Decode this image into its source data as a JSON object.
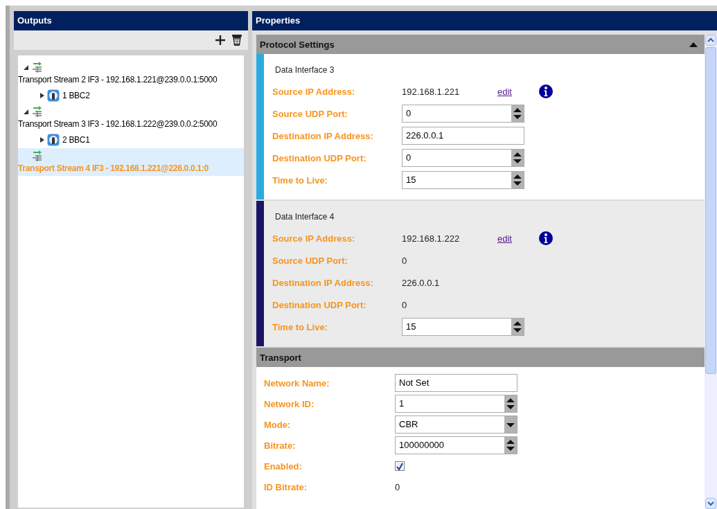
{
  "outputs": {
    "title": "Outputs",
    "toolbar": [
      {
        "kind": "add"
      },
      {
        "kind": "delete"
      }
    ],
    "tree": [
      {
        "label": "Transport Stream 2 IF3 - 192.168.1.221@239.0.0.1:5000",
        "expanded": true,
        "selected": false,
        "children": [
          {
            "label": "1 BBC2",
            "expanded": false
          }
        ]
      },
      {
        "label": "Transport Stream 3 IF3 - 192.168.1.222@239.0.0.2:5000",
        "expanded": true,
        "selected": false,
        "children": [
          {
            "label": "2 BBC1",
            "expanded": false
          }
        ]
      },
      {
        "label": "Transport Stream 4 IF3 - 192.168.1.221@226.0.0.1:0",
        "selected": true
      }
    ]
  },
  "properties": {
    "title": "Properties",
    "protocol_settings": {
      "title": "Protocol Settings",
      "expanded": true,
      "interfaces": [
        {
          "title": "Data Interface 3",
          "color": "#29abe2",
          "selected": false,
          "rows": [
            {
              "label": "Source IP Address:",
              "kind": "text",
              "value": "192.168.1.221",
              "link": "edit",
              "info": true
            },
            {
              "label": "Source UDP Port:",
              "kind": "spin",
              "value": "0"
            },
            {
              "label": "Destination IP Address:",
              "kind": "input",
              "value": "226.0.0.1"
            },
            {
              "label": "Destination UDP Port:",
              "kind": "spin",
              "value": "0"
            },
            {
              "label": "Time to Live:",
              "kind": "spin",
              "value": "15"
            }
          ]
        },
        {
          "title": "Data Interface 4",
          "color": "#1b1464",
          "selected": true,
          "rows": [
            {
              "label": "Source IP Address:",
              "kind": "text",
              "value": "192.168.1.222",
              "link": "edit",
              "info": true
            },
            {
              "label": "Source UDP Port:",
              "kind": "text",
              "value": "0"
            },
            {
              "label": "Destination IP Address:",
              "kind": "text",
              "value": "226.0.0.1"
            },
            {
              "label": "Destination UDP Port:",
              "kind": "text",
              "value": "0"
            },
            {
              "label": "Time to Live:",
              "kind": "spin",
              "value": "15"
            }
          ]
        }
      ]
    },
    "transport": {
      "title": "Transport",
      "rows": [
        {
          "label": "Network Name:",
          "kind": "input",
          "value": "Not Set"
        },
        {
          "label": "Network ID:",
          "kind": "spin",
          "value": "1"
        },
        {
          "label": "Mode:",
          "kind": "select",
          "value": "CBR"
        },
        {
          "label": "Bitrate:",
          "kind": "spin",
          "value": "100000000"
        },
        {
          "label": "Enabled:",
          "kind": "checkbox",
          "checked": true
        },
        {
          "label": "ID Bitrate:",
          "kind": "text",
          "value": "0"
        }
      ]
    }
  }
}
